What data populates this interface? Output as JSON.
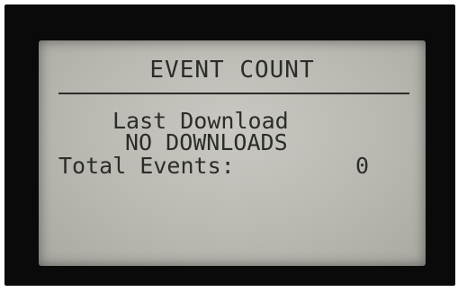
{
  "display": {
    "title": "EVENT COUNT",
    "last_download_label": "Last Download",
    "last_download_value": "NO DOWNLOADS",
    "total_events_label": "Total Events:",
    "total_events_value": "0"
  },
  "colors": {
    "bezel": "#0a0a0a",
    "lcd_background": "#bdbcb5",
    "lcd_text": "#2c2c2a"
  }
}
